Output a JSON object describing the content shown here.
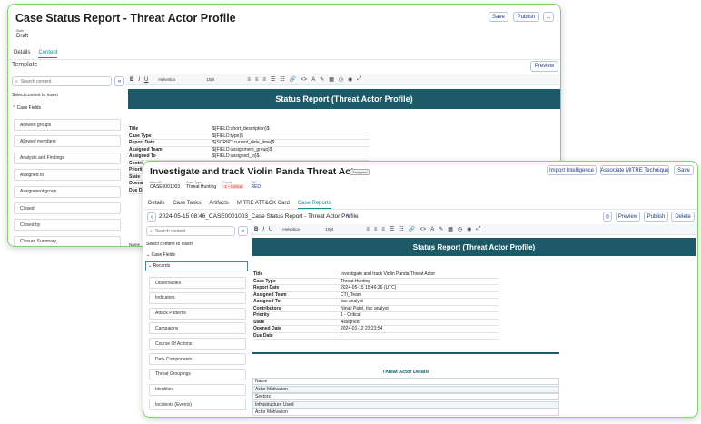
{
  "back": {
    "title": "Case Status Report - Threat Actor Profile",
    "state_label": "State",
    "state_value": "Draft",
    "save_label": "Save",
    "publish_label": "Publish",
    "more_label": "...",
    "tabs": [
      "Details",
      "Content"
    ],
    "active_tab": "Content",
    "template_label": "Template",
    "preview_label": "Preview",
    "toolbar": {
      "font": "Helvetica",
      "size": "10pt"
    },
    "search_placeholder": "Search content",
    "select_prompt": "Select content to insert",
    "case_fields_label": "Case Fields",
    "items": [
      "Allowed groups",
      "Allowed members",
      "Analysis and Findings",
      "Assigned to",
      "Assignment group",
      "Closed",
      "Closed by",
      "Closure Summary"
    ],
    "banner": "Status Report (Threat Actor Profile)",
    "fields": [
      {
        "k": "Title",
        "v": "${FIELD:short_description}$"
      },
      {
        "k": "Case Type",
        "v": "${FIELD:type}$"
      },
      {
        "k": "Report Date",
        "v": "${SCRIPT:current_date_time}$"
      },
      {
        "k": "Assigned Team",
        "v": "${FIELD:assignment_group}$"
      },
      {
        "k": "Assigned To",
        "v": "${FIELD:assigned_to}$"
      },
      {
        "k": "Contri",
        "v": ""
      },
      {
        "k": "Priorit",
        "v": ""
      },
      {
        "k": "State",
        "v": ""
      },
      {
        "k": "Opened",
        "v": ""
      },
      {
        "k": "Due Da",
        "v": ""
      }
    ],
    "partial_label": "Name"
  },
  "front": {
    "title": "Investigate and track Violin Panda Threat Actor",
    "status_badge": "Assigned",
    "meta": [
      {
        "label": "Case ID",
        "value": "CASE0001003"
      },
      {
        "label": "Case Type",
        "value": "Threat Hunting"
      },
      {
        "label": "Priority",
        "value": "1 - Critical"
      },
      {
        "label": "TLP",
        "value": "RED"
      }
    ],
    "actions": [
      "Import Intelligence",
      "Associate MITRE Technique",
      "Save"
    ],
    "tabs": [
      "Details",
      "Case Tasks",
      "Artifacts",
      "MITRE ATT&CK Card",
      "Case Reports"
    ],
    "active_tab": "Case Reports",
    "report_name": "2024-05-15 08:46_CASE0001003_Case Status Report - Threat Actor Profile",
    "preview_label": "Preview",
    "publish_label": "Publish",
    "delete_label": "Delete",
    "toolbar": {
      "font": "Helvetica",
      "size": "10pt"
    },
    "search_placeholder": "Search content",
    "select_prompt": "Select content to insert",
    "case_fields_label": "Case Fields",
    "records_label": "Records",
    "items": [
      "Observables",
      "Indicators",
      "Attack Patterns",
      "Campaigns",
      "Course Of Actions",
      "Data Components",
      "Threat Groupings",
      "Identities",
      "Incidents (Events)"
    ],
    "banner": "Status Report (Threat Actor Profile)",
    "fields": [
      {
        "k": "Title",
        "v": "Investigate and track Violin Panda Threat Actor"
      },
      {
        "k": "Case Type",
        "v": "Threat Hunting"
      },
      {
        "k": "Report Date",
        "v": "2024-05-15 15:46:26 (UTC)"
      },
      {
        "k": "Assigned Team",
        "v": "CTI_Team"
      },
      {
        "k": "Assigned To",
        "v": "tisc analyst"
      },
      {
        "k": "Contributors",
        "v": "Ninali Patel, tisc analyst"
      },
      {
        "k": "Priority",
        "v": "1 - Critical"
      },
      {
        "k": "State",
        "v": "Assigned"
      },
      {
        "k": "Opened Date",
        "v": "2024-01-12 23:23:54"
      },
      {
        "k": "Due Date",
        "v": "-"
      }
    ],
    "details_title": "Threat Actor Details",
    "detail_rows": [
      "Name",
      "Actor Motivation",
      "Sectors",
      "Infrastructure Used",
      "Actor Motivation"
    ]
  }
}
